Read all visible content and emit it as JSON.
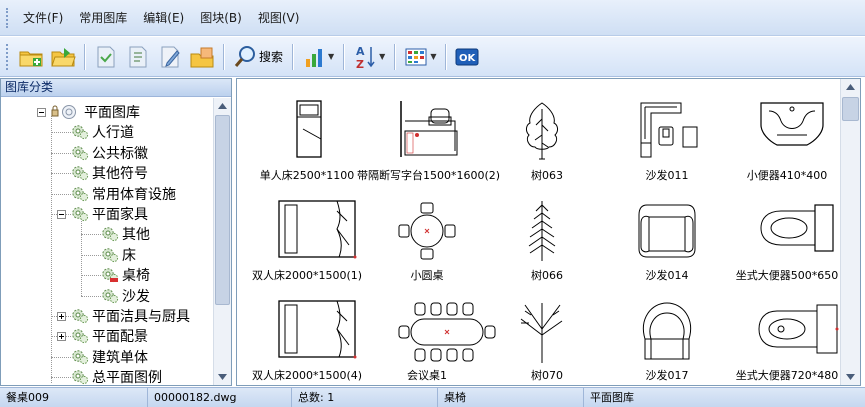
{
  "menu": [
    {
      "id": "file",
      "label": "文件(F)"
    },
    {
      "id": "lib",
      "label": "常用图库"
    },
    {
      "id": "edit",
      "label": "编辑(E)"
    },
    {
      "id": "block",
      "label": "图块(B)"
    },
    {
      "id": "view",
      "label": "视图(V)"
    }
  ],
  "toolbar": {
    "search_label": "搜索",
    "ok_label": "OK",
    "icons": [
      "new-folder-icon",
      "open-folder-icon",
      "import-icon",
      "export-icon",
      "edit-icon",
      "copy-icon",
      "search-icon",
      "chart-icon",
      "sort-az-icon",
      "view-grid-icon",
      "ok-icon"
    ]
  },
  "left_panel": {
    "title": "图库分类",
    "tree": [
      {
        "label": "平面图库",
        "level": 0,
        "toggle": "minus"
      },
      {
        "label": "人行道",
        "level": 1
      },
      {
        "label": "公共标徽",
        "level": 1
      },
      {
        "label": "其他符号",
        "level": 1
      },
      {
        "label": "常用体育设施",
        "level": 1
      },
      {
        "label": "平面家具",
        "level": 1,
        "toggle": "minus"
      },
      {
        "label": "其他",
        "level": 2
      },
      {
        "label": "床",
        "level": 2
      },
      {
        "label": "桌椅",
        "level": 2,
        "selected": true
      },
      {
        "label": "沙发",
        "level": 2
      },
      {
        "label": "平面洁具与厨具",
        "level": 1,
        "toggle": "plus"
      },
      {
        "label": "平面配景",
        "level": 1,
        "toggle": "plus"
      },
      {
        "label": "建筑单体",
        "level": 1
      },
      {
        "label": "总平面图例",
        "level": 1
      }
    ]
  },
  "thumbnails": [
    {
      "label": "单人床2500*1100",
      "icon": "single-bed-icon"
    },
    {
      "label": "带隔断写字台1500*1600(2)",
      "icon": "desk-partition-icon"
    },
    {
      "label": "树063",
      "icon": "tree-icon"
    },
    {
      "label": "沙发011",
      "icon": "sofa-set-icon"
    },
    {
      "label": "小便器410*400",
      "icon": "urinal-icon"
    },
    {
      "label": "双人床2000*1500(1)",
      "icon": "double-bed-icon"
    },
    {
      "label": "小圆桌",
      "icon": "round-table-icon"
    },
    {
      "label": "树066",
      "icon": "conifer-icon"
    },
    {
      "label": "沙发014",
      "icon": "armchair-icon"
    },
    {
      "label": "坐式大便器500*650",
      "icon": "toilet-icon"
    },
    {
      "label": "双人床2000*1500(4)",
      "icon": "double-bed-icon"
    },
    {
      "label": "会议桌1",
      "icon": "conference-table-icon"
    },
    {
      "label": "树070",
      "icon": "bare-tree-icon"
    },
    {
      "label": "沙发017",
      "icon": "round-armchair-icon"
    },
    {
      "label": "坐式大便器720*480",
      "icon": "toilet-side-icon"
    }
  ],
  "status": {
    "name": "餐桌009",
    "file": "00000182.dwg",
    "total": "总数: 1",
    "category": "桌椅",
    "library": "平面图库"
  }
}
